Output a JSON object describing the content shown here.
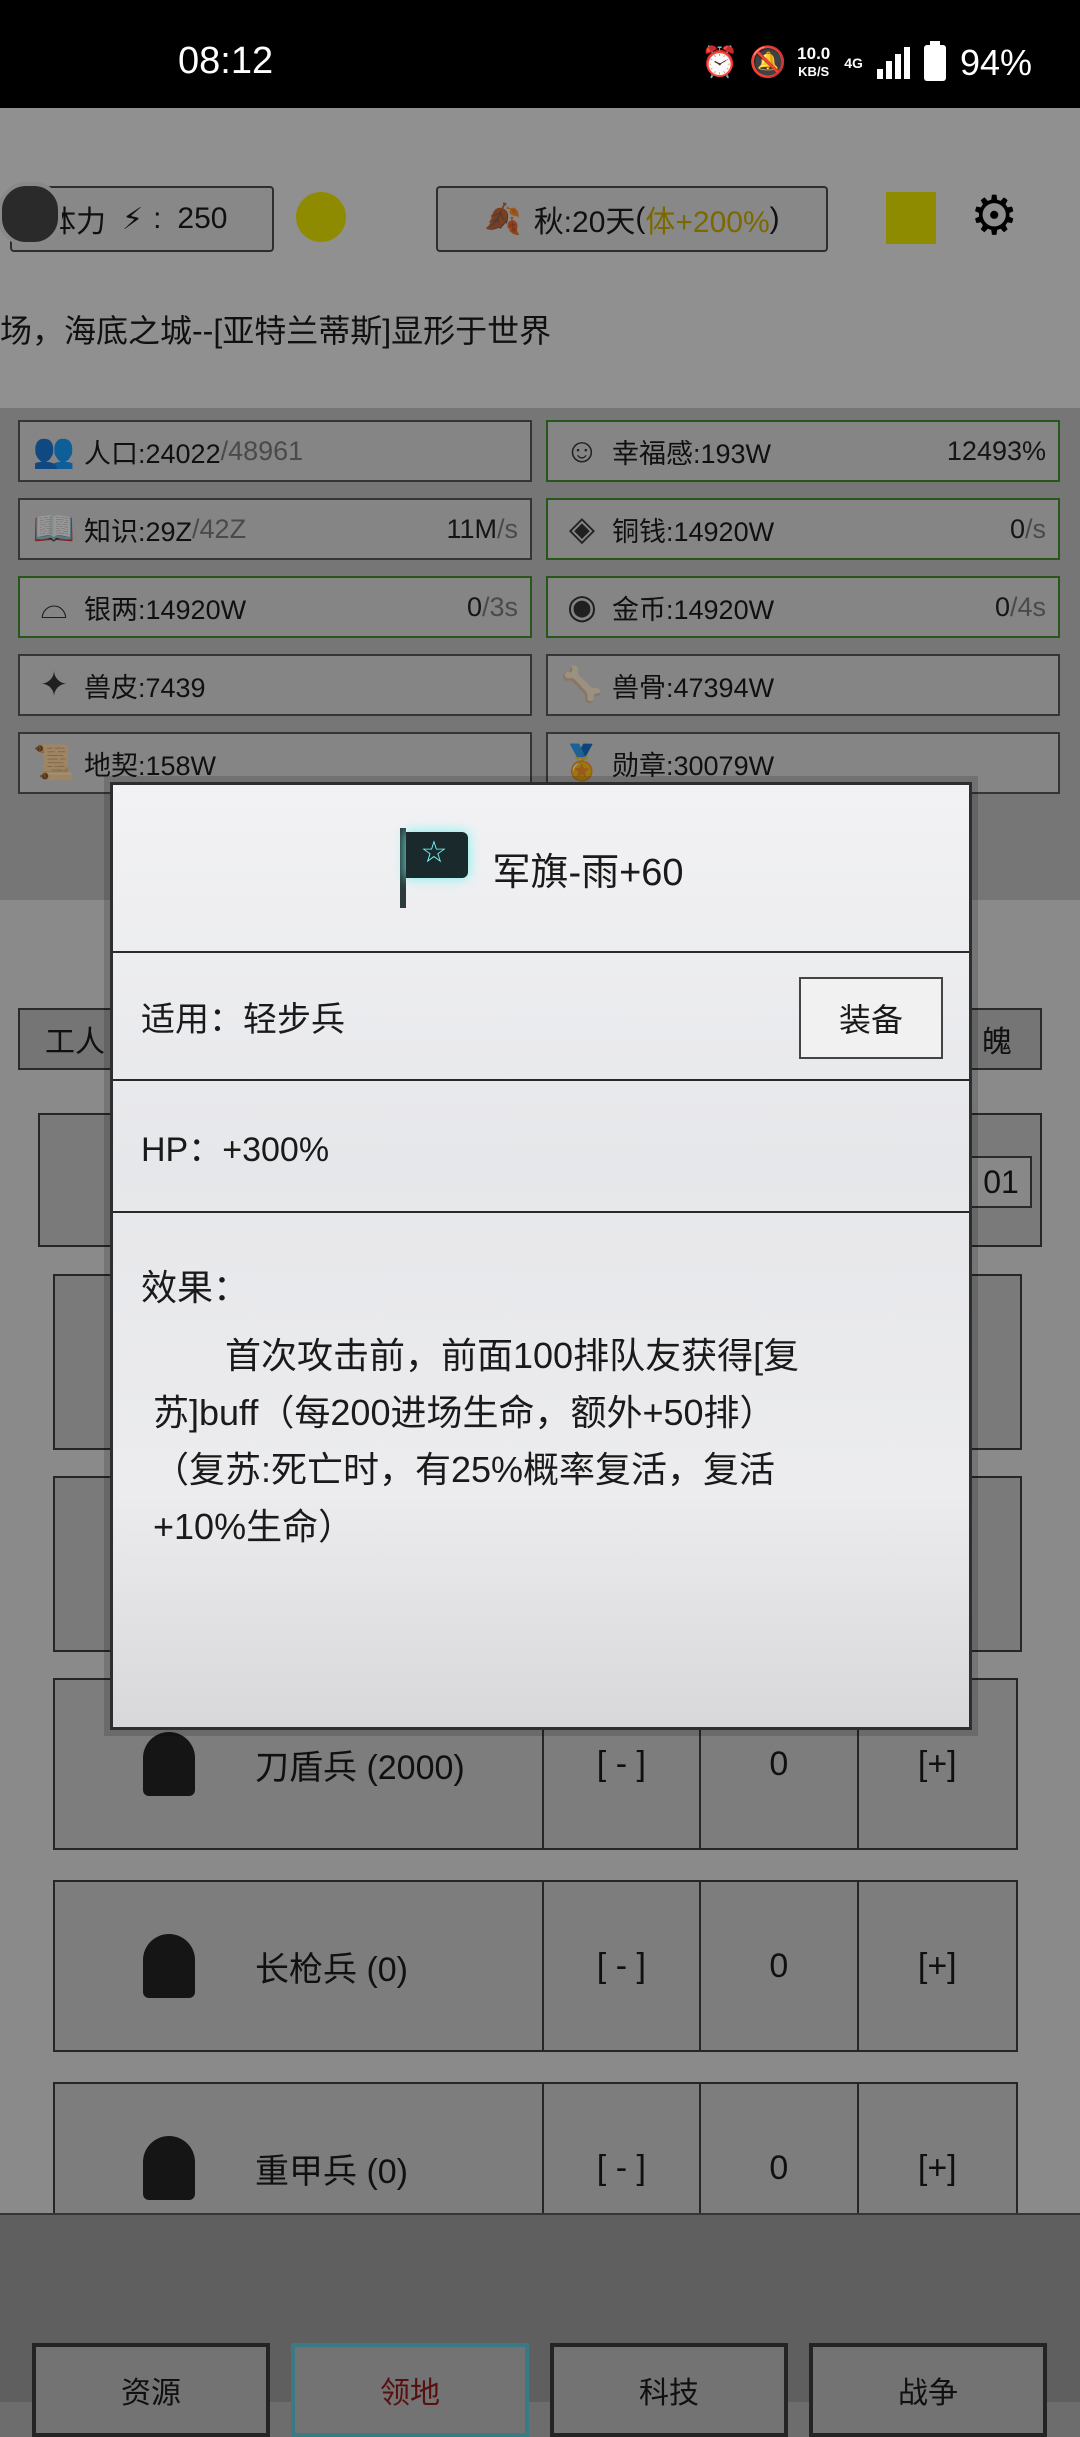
{
  "status_bar": {
    "time": "08:12",
    "net_speed": "10.0",
    "net_unit": "KB/S",
    "net_type": "4G",
    "battery": "94%"
  },
  "top": {
    "stamina_label": "体力",
    "stamina_value": "250",
    "season": "秋:20天",
    "season_bonus_open": "(",
    "season_bonus": "体+200%",
    "season_bonus_close": ")"
  },
  "marquee": "场，海底之城--[亚特兰蒂斯]显形于世界",
  "stats": [
    {
      "label": "人口:24022",
      "extra": "/48961",
      "rate": "",
      "rate_extra": ""
    },
    {
      "label": "幸福感:193W",
      "extra": "",
      "rate": "12493%",
      "rate_extra": ""
    },
    {
      "label": "知识:29Z",
      "extra": "/42Z",
      "rate": "11M",
      "rate_extra": "/s"
    },
    {
      "label": "铜钱:14920W",
      "extra": "",
      "rate": "0",
      "rate_extra": "/s"
    },
    {
      "label": "银两:14920W",
      "extra": "",
      "rate": "0",
      "rate_extra": "/3s"
    },
    {
      "label": "金币:14920W",
      "extra": "",
      "rate": "0",
      "rate_extra": "/4s"
    },
    {
      "label": "兽皮:7439",
      "extra": "",
      "rate": "",
      "rate_extra": ""
    },
    {
      "label": "兽骨:47394W",
      "extra": "",
      "rate": "",
      "rate_extra": ""
    },
    {
      "label": "地契:158W",
      "extra": "",
      "rate": "",
      "rate_extra": ""
    },
    {
      "label": "勋章:30079W",
      "extra": "",
      "rate": "",
      "rate_extra": ""
    }
  ],
  "tabs_partial": {
    "left": "工人",
    "right": "魄"
  },
  "row_value_partial": "01",
  "units": [
    {
      "name": "刀盾兵 (2000)",
      "minus": "[ - ]",
      "count": "0",
      "plus": "[+]"
    },
    {
      "name": "长枪兵 (0)",
      "minus": "[ - ]",
      "count": "0",
      "plus": "[+]"
    },
    {
      "name": "重甲兵 (0)",
      "minus": "[ - ]",
      "count": "0",
      "plus": "[+]"
    }
  ],
  "bottom_nav": [
    "资源",
    "领地",
    "科技",
    "战争"
  ],
  "dialog": {
    "title": "军旗-雨+60",
    "applies_label": "适用：轻步兵",
    "equip_button": "装备",
    "hp": "HP：+300%",
    "effect_title": "效果：",
    "effect_line1": "　　首次攻击前，前面100排队友获得[复",
    "effect_line2": "苏]buff（每200进场生命，额外+50排）",
    "effect_line3": "（复苏:死亡时，有25%概率复活，复活",
    "effect_line4": "+10%生命）"
  }
}
